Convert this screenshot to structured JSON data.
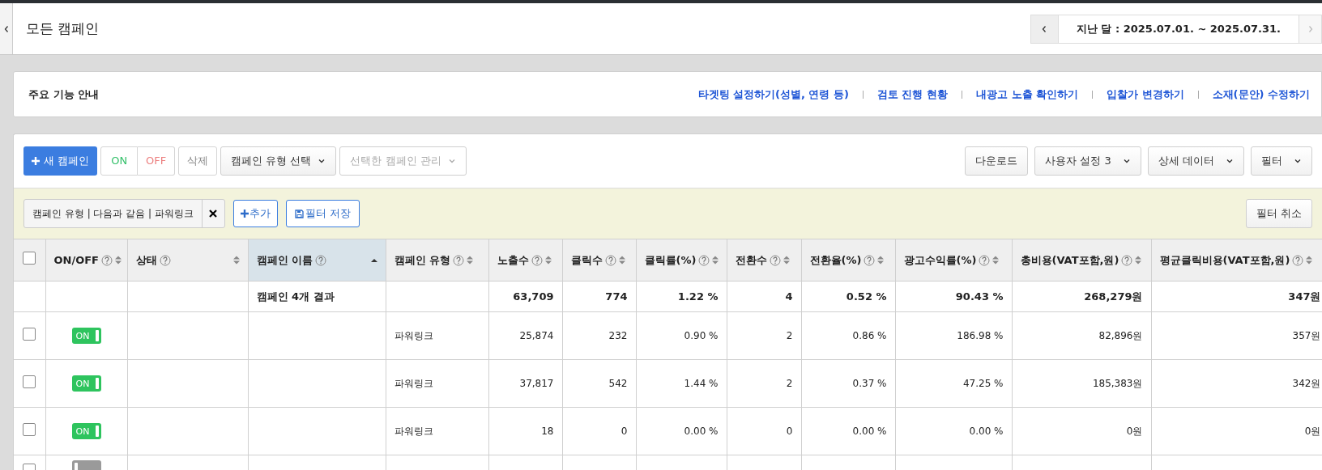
{
  "header": {
    "title": "모든 캠페인",
    "date_range": "지난 달 : 2025.07.01. ~ 2025.07.31.",
    "next_disabled": true
  },
  "guide": {
    "title": "주요 기능 안내",
    "links": [
      "타겟팅 설정하기(성별, 연령 등)",
      "검토 진행 현황",
      "내광고 노출 확인하기",
      "입찰가 변경하기",
      "소재(문안) 수정하기"
    ]
  },
  "toolbar": {
    "new_button": "새 캠페인",
    "on_button": "ON",
    "off_button": "OFF",
    "delete_button": "삭제",
    "dropdowns_left": [
      {
        "label": "캠페인 유형 선택",
        "disabled": false
      },
      {
        "label": "선택한 캠페인 관리",
        "disabled": true
      }
    ],
    "download_button": "다운로드",
    "dropdowns_right": [
      {
        "label": "사용자 설정 3",
        "disabled": false
      },
      {
        "label": "상세 데이터",
        "disabled": false
      },
      {
        "label": "필터",
        "disabled": false
      }
    ]
  },
  "filter_bar": {
    "chip": "캠페인 유형 | 다음과 같음 | 파워링크",
    "add_button": "추가",
    "save_button": "필터 저장",
    "cancel_button": "필터 취소"
  },
  "table": {
    "header_checkbox": {
      "checked": false
    },
    "columns": [
      {
        "label": "ON/OFF",
        "sorted": false
      },
      {
        "label": "상태",
        "sorted": false
      },
      {
        "label": "캠페인 이름",
        "sorted": true
      },
      {
        "label": "캠페인 유형",
        "sorted": false
      },
      {
        "label": "노출수",
        "sorted": false
      },
      {
        "label": "클릭수",
        "sorted": false
      },
      {
        "label": "클릭률(%)",
        "sorted": false
      },
      {
        "label": "전환수",
        "sorted": false
      },
      {
        "label": "전환율(%)",
        "sorted": false
      },
      {
        "label": "광고수익률(%)",
        "sorted": false
      },
      {
        "label": "총비용(VAT포함,원)",
        "sorted": false
      },
      {
        "label": "평균클릭비용(VAT포함,원)",
        "sorted": false
      }
    ],
    "summary": {
      "name": "캠페인 4개 결과",
      "values": [
        "63,709",
        "774",
        "1.22 %",
        "4",
        "0.52 %",
        "90.43 %",
        "268,279원",
        "347원"
      ]
    },
    "rows": [
      {
        "checked": false,
        "on": true,
        "on_label": "ON",
        "type": "파워링크",
        "values": [
          "25,874",
          "232",
          "0.90 %",
          "2",
          "0.86 %",
          "186.98 %",
          "82,896원",
          "357원"
        ]
      },
      {
        "checked": false,
        "on": true,
        "on_label": "ON",
        "type": "파워링크",
        "values": [
          "37,817",
          "542",
          "1.44 %",
          "2",
          "0.37 %",
          "47.25 %",
          "185,383원",
          "342원"
        ]
      },
      {
        "checked": false,
        "on": true,
        "on_label": "ON",
        "type": "파워링크",
        "values": [
          "18",
          "0",
          "0.00 %",
          "0",
          "0.00 %",
          "0.00 %",
          "0원",
          "0원"
        ]
      },
      {
        "checked": false,
        "on": false
      }
    ]
  }
}
